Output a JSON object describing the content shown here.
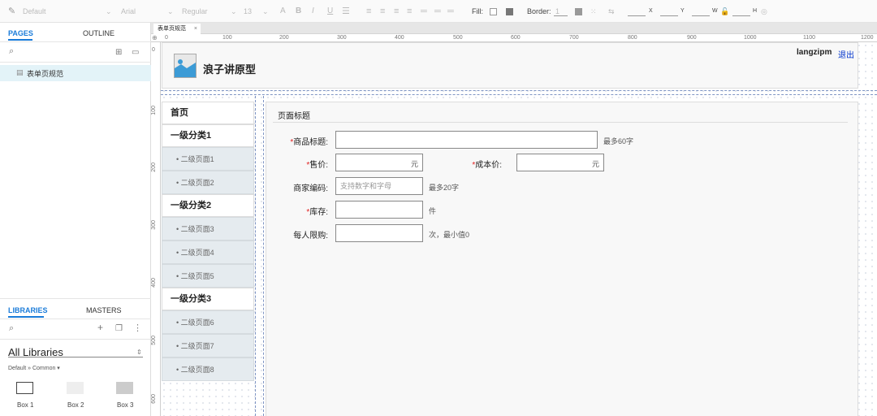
{
  "toolbar": {
    "style": "Default",
    "font": "Arial",
    "weight": "Regular",
    "size": "13",
    "fill_label": "Fill:",
    "border_label": "Border:",
    "border_value": "1",
    "x_label": "X",
    "y_label": "Y",
    "w_label": "W",
    "h_label": "H"
  },
  "left_panel": {
    "tab_pages": "PAGES",
    "tab_outline": "OUTLINE",
    "page_item": "表单页规范",
    "tab_libraries": "LIBRARIES",
    "tab_masters": "MASTERS",
    "library_select": "All Libraries",
    "library_path": "Default » Common ▾",
    "boxes": [
      "Box 1",
      "Box 2",
      "Box 3"
    ]
  },
  "canvas": {
    "doc_tab": "表单页规范",
    "ruler_h": [
      "0",
      "100",
      "200",
      "300",
      "400",
      "500",
      "600",
      "700",
      "800",
      "900",
      "1000",
      "1100",
      "1200"
    ],
    "ruler_v": [
      "100",
      "200",
      "300",
      "400",
      "500",
      "600"
    ]
  },
  "prototype": {
    "site_title": "浪子讲原型",
    "user": "langzipm",
    "logout": "退出",
    "nav": [
      {
        "label": "首页",
        "level": 1
      },
      {
        "label": "一级分类1",
        "level": 1
      },
      {
        "label": "• 二级页面1",
        "level": 2
      },
      {
        "label": "• 二级页面2",
        "level": 2
      },
      {
        "label": "一级分类2",
        "level": 1
      },
      {
        "label": "• 二级页面3",
        "level": 2
      },
      {
        "label": "• 二级页面4",
        "level": 2
      },
      {
        "label": "• 二级页面5",
        "level": 2
      },
      {
        "label": "一级分类3",
        "level": 1
      },
      {
        "label": "• 二级页面6",
        "level": 2
      },
      {
        "label": "• 二级页面7",
        "level": 2
      },
      {
        "label": "• 二级页面8",
        "level": 2
      }
    ],
    "page_title": "页面标题",
    "form": {
      "title_label": "商品标题:",
      "title_hint": "最多60字",
      "price_label": "售价:",
      "price_unit": "元",
      "cost_label": "成本价:",
      "cost_unit": "元",
      "code_label": "商家编码:",
      "code_placeholder": "支持数字和字母",
      "code_hint": "最多20字",
      "stock_label": "库存:",
      "stock_unit": "件",
      "limit_label": "每人限购:",
      "limit_hint": "次，最小值0",
      "required_mark": "*"
    }
  },
  "colors": {
    "accent": "#1a7bd9",
    "required": "#e02020",
    "link": "#0033cc",
    "nav_sub_bg": "#e5ebef",
    "selected_page_bg": "#e3f3f8"
  }
}
